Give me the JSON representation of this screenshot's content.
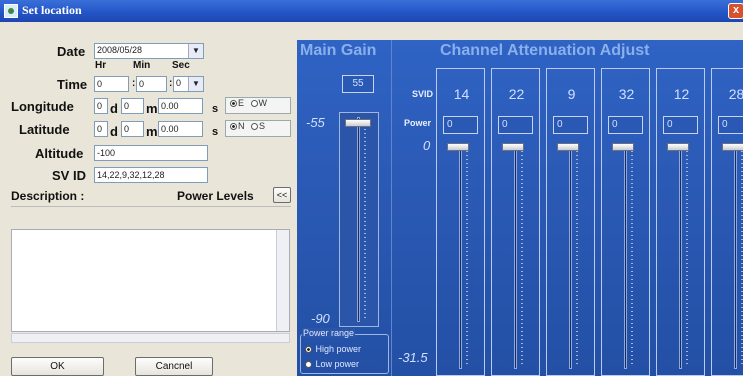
{
  "window": {
    "title": "Set location",
    "close_label": "x"
  },
  "form": {
    "date_label": "Date",
    "date_value": "2008/05/28",
    "time_label": "Time",
    "hr_label": "Hr",
    "min_label": "Min",
    "sec_label": "Sec",
    "hr_value": "0",
    "min_value": "0",
    "sec_value": "0",
    "colon": ":",
    "longitude_label": "Longitude",
    "lon_deg": "0",
    "lon_min": "0",
    "lon_sec": "0.00",
    "d_label": "d",
    "m_label": "m",
    "s_label": "s",
    "lon_e": "E",
    "lon_w": "W",
    "latitude_label": "Latitude",
    "lat_deg": "0",
    "lat_min": "0",
    "lat_sec": "0.00",
    "lat_n": "N",
    "lat_s": "S",
    "altitude_label": "Altitude",
    "altitude_value": "-100",
    "svid_label": "SV ID",
    "svid_value": "14,22,9,32,12,28",
    "description_label": "Description :",
    "power_levels_label": "Power Levels",
    "collapse_label": "<<"
  },
  "buttons": {
    "ok": "OK",
    "cancel": "Cancnel"
  },
  "main_gain": {
    "title": "Main Gain",
    "value": "55",
    "max_label": "-55",
    "min_label": "-90",
    "level": 0.0
  },
  "power_range": {
    "title": "Power range",
    "high": "High power",
    "low": "Low power",
    "selected": "high"
  },
  "attenuation": {
    "title": "Channel Attenuation  Adjust",
    "svid_label": "SVID",
    "power_label": "Power",
    "top_label": "0",
    "bottom_label": "-31.5",
    "channels": [
      {
        "svid": "14",
        "power": "0"
      },
      {
        "svid": "22",
        "power": "0"
      },
      {
        "svid": "9",
        "power": "0"
      },
      {
        "svid": "32",
        "power": "0"
      },
      {
        "svid": "12",
        "power": "0"
      },
      {
        "svid": "28",
        "power": "0"
      }
    ]
  }
}
